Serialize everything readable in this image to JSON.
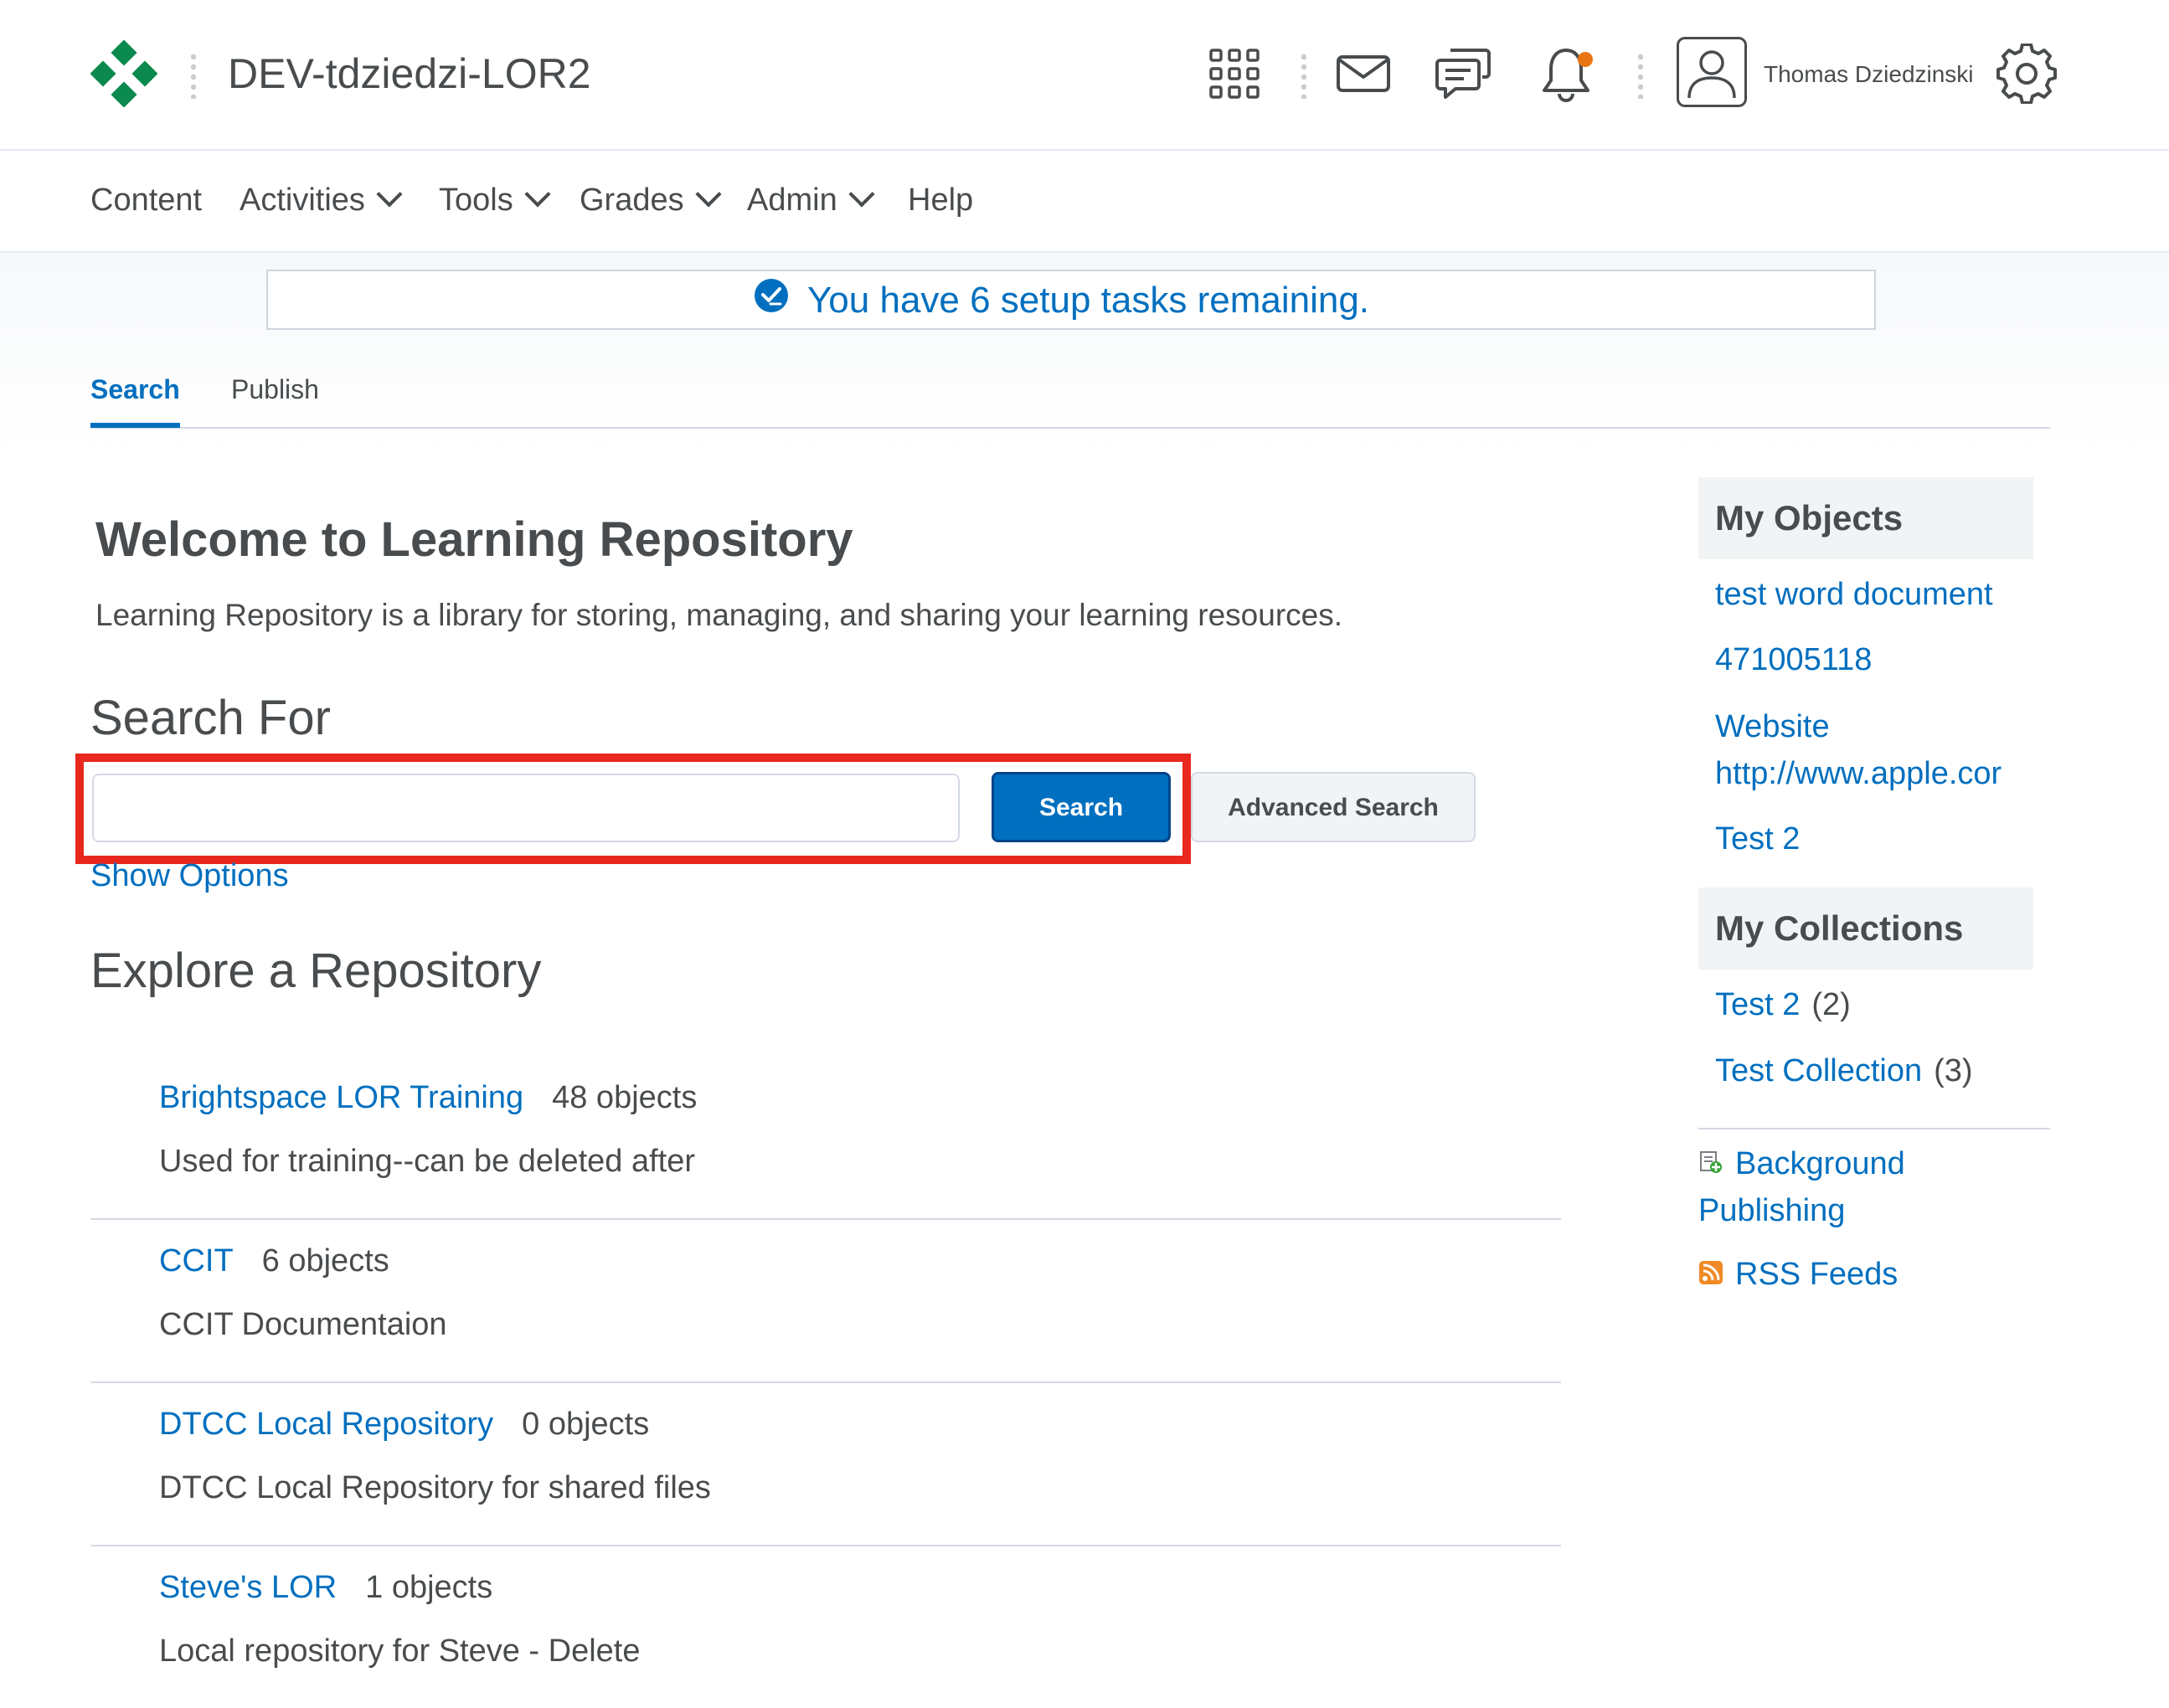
{
  "header": {
    "org_title": "DEV-tdziedzi-LOR2",
    "user_name": "Thomas Dziedzinski",
    "brand_color": "#0a8a4e",
    "icons": [
      "waffle-icon",
      "mail-icon",
      "chat-icon",
      "bell-icon",
      "avatar",
      "gear-icon"
    ]
  },
  "nav": {
    "items": [
      {
        "label": "Content",
        "has_menu": false
      },
      {
        "label": "Activities",
        "has_menu": true
      },
      {
        "label": "Tools",
        "has_menu": true
      },
      {
        "label": "Grades",
        "has_menu": true
      },
      {
        "label": "Admin",
        "has_menu": true
      },
      {
        "label": "Help",
        "has_menu": false
      }
    ]
  },
  "setup_banner": {
    "text": "You have 6 setup tasks remaining."
  },
  "tabs": {
    "search": "Search",
    "publish": "Publish",
    "active": "Search"
  },
  "main": {
    "welcome_title": "Welcome to Learning Repository",
    "welcome_desc": "Learning Repository is a library for storing, managing, and sharing your learning resources.",
    "search_heading": "Search For",
    "search_value": "",
    "search_button": "Search",
    "advanced_button": "Advanced Search",
    "show_options": "Show Options",
    "explore_heading": "Explore a Repository",
    "repositories": [
      {
        "name": "Brightspace LOR Training",
        "count": "48 objects",
        "description": "Used for training--can be deleted after"
      },
      {
        "name": "CCIT",
        "count": "6 objects",
        "description": "CCIT Documentaion"
      },
      {
        "name": "DTCC Local Repository",
        "count": "0 objects",
        "description": "DTCC Local Repository for shared files"
      },
      {
        "name": "Steve's LOR",
        "count": "1 objects",
        "description": "Local repository for Steve - Delete"
      }
    ]
  },
  "sidebar": {
    "my_objects_title": "My Objects",
    "my_objects": [
      "test word document",
      "471005118",
      "Website",
      "http://www.apple.cor",
      "Test 2"
    ],
    "my_collections_title": "My Collections",
    "my_collections": [
      {
        "name": "Test 2",
        "count": "(2)"
      },
      {
        "name": "Test Collection",
        "count": "(3)"
      }
    ],
    "background_publishing_line1": "Background",
    "background_publishing_line2": "Publishing",
    "rss_feeds": "RSS Feeds"
  },
  "colors": {
    "link": "#006fbf",
    "text": "#494c4e",
    "highlight_box": "#e8281e",
    "notification_dot": "#e87511"
  }
}
